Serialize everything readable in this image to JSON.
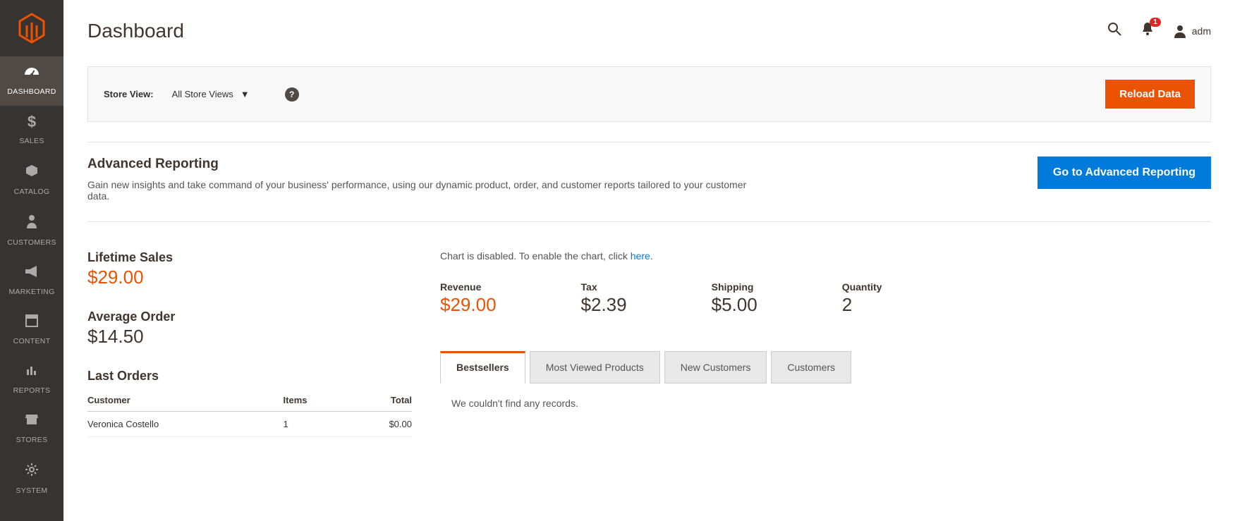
{
  "sidebar": {
    "items": [
      {
        "label": "DASHBOARD",
        "icon": "◐"
      },
      {
        "label": "SALES",
        "icon": "$"
      },
      {
        "label": "CATALOG",
        "icon": "◪"
      },
      {
        "label": "CUSTOMERS",
        "icon": "👤"
      },
      {
        "label": "MARKETING",
        "icon": "📣"
      },
      {
        "label": "CONTENT",
        "icon": "▤"
      },
      {
        "label": "REPORTS",
        "icon": "▮▮"
      },
      {
        "label": "STORES",
        "icon": "🏬"
      },
      {
        "label": "SYSTEM",
        "icon": "⚙"
      }
    ]
  },
  "header": {
    "title": "Dashboard",
    "notification_count": "1",
    "user_name": "adm"
  },
  "toolbar": {
    "store_view_label": "Store View:",
    "store_view_value": "All Store Views",
    "reload_label": "Reload Data"
  },
  "advanced": {
    "title": "Advanced Reporting",
    "desc": "Gain new insights and take command of your business' performance, using our dynamic product, order, and customer reports tailored to your customer data.",
    "button": "Go to Advanced Reporting"
  },
  "stats": {
    "lifetime_label": "Lifetime Sales",
    "lifetime_value": "$29.00",
    "avg_label": "Average Order",
    "avg_value": "$14.50"
  },
  "orders": {
    "title": "Last Orders",
    "cols": {
      "customer": "Customer",
      "items": "Items",
      "total": "Total"
    },
    "rows": [
      {
        "customer": "Veronica Costello",
        "items": "1",
        "total": "$0.00"
      }
    ]
  },
  "chart": {
    "note_prefix": "Chart is disabled. To enable the chart, click ",
    "note_link": "here",
    "note_suffix": "."
  },
  "metrics": {
    "revenue_label": "Revenue",
    "revenue_value": "$29.00",
    "tax_label": "Tax",
    "tax_value": "$2.39",
    "shipping_label": "Shipping",
    "shipping_value": "$5.00",
    "quantity_label": "Quantity",
    "quantity_value": "2"
  },
  "tabs": {
    "items": [
      "Bestsellers",
      "Most Viewed Products",
      "New Customers",
      "Customers"
    ],
    "empty_msg": "We couldn't find any records."
  }
}
